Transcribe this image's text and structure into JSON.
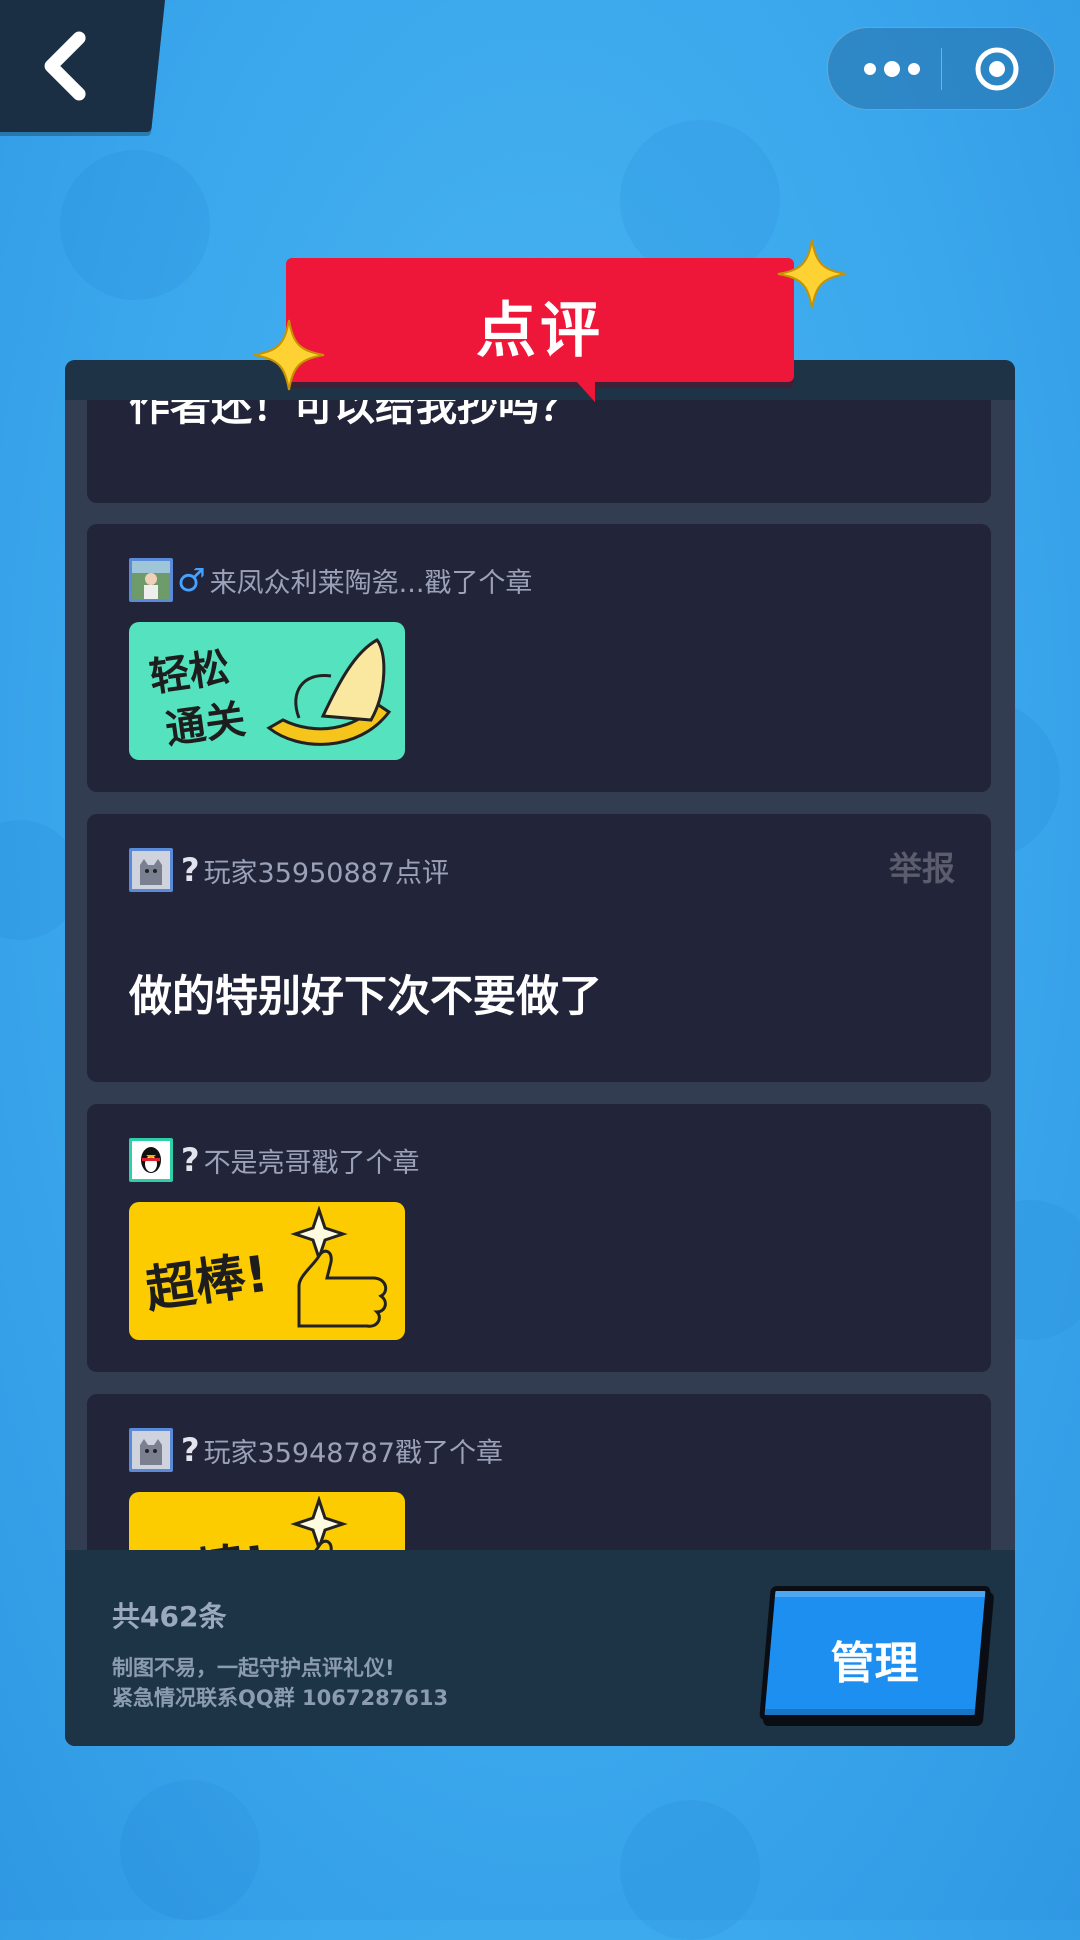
{
  "nav": {
    "back_icon": "chevron-left-icon"
  },
  "capsule": {
    "more_icon": "more-dots-icon",
    "close_icon": "target-circle-icon"
  },
  "header": {
    "title": "点评"
  },
  "comments": [
    {
      "type": "text",
      "text": "作者还！可以给我抄吗？"
    },
    {
      "type": "stamp",
      "gender": "♂",
      "name": "来凤众利莱陶瓷...戳了个章",
      "stamp": "轻松通关",
      "stamp_lines": [
        "轻松",
        "通关"
      ],
      "stamp_color": "#55e2bf"
    },
    {
      "type": "review",
      "qmark": "?",
      "name": "玩家35950887点评",
      "report": "举报",
      "text": "做的特别好下次不要做了"
    },
    {
      "type": "stamp",
      "qmark": "?",
      "name": "不是亮哥戳了个章",
      "stamp": "超棒!",
      "stamp_color": "#fdcc00"
    },
    {
      "type": "stamp",
      "qmark": "?",
      "name": "玩家35948787戳了个章",
      "stamp": "超棒!",
      "stamp_color": "#fdcc00"
    }
  ],
  "footer": {
    "total": "共462条",
    "notice_line1": "制图不易，一起守护点评礼仪!",
    "notice_line2": "紧急情况联系QQ群 1067287613",
    "manage_label": "管理"
  },
  "colors": {
    "accent_red": "#ee1739",
    "button_blue": "#1d8ff0",
    "card_bg": "#222439",
    "panel_bg": "#333d51"
  }
}
